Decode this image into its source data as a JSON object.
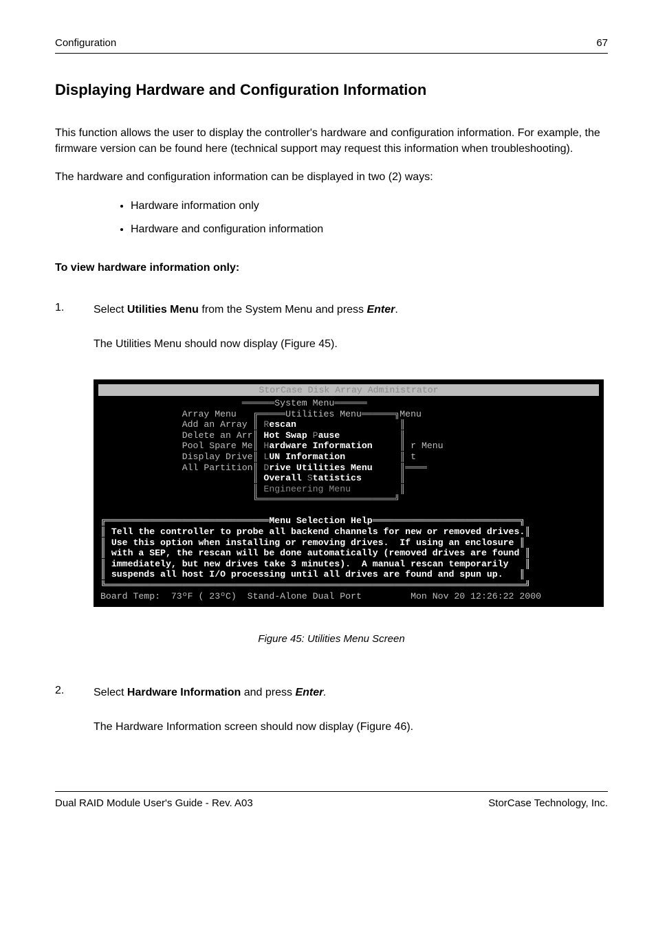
{
  "header": {
    "left": "Configuration",
    "right": "67"
  },
  "section": {
    "title": "Displaying Hardware and Configuration Information",
    "intro_p1": "This function allows the user to display the controller's hardware and configuration information.  For example, the firmware version can be found here (technical support may request this information when troubleshooting).",
    "intro_p2": "The hardware and configuration information can be displayed in two (2) ways:",
    "bullets": [
      "Hardware information only",
      "Hardware and configuration information"
    ],
    "subhead": "To view hardware information only:"
  },
  "steps": {
    "s1": {
      "num": "1.",
      "line1_a": "Select ",
      "line1_b": "Utilities Menu",
      "line1_c": " from the System Menu and press ",
      "line1_d": "Enter",
      "line1_e": ".",
      "line2": "The Utilities Menu should now display (Figure 45)."
    },
    "s2": {
      "num": "2.",
      "line1_a": "Select ",
      "line1_b": "Hardware Information",
      "line1_c": " and press ",
      "line1_d": "Enter",
      "line1_e": ".",
      "line2": "The Hardware Information screen should now display (Figure 46)."
    }
  },
  "terminal": {
    "titlebar": "StorCase Disk Array Administrator",
    "lines": {
      "l01": "                          ══════System Menu══════                          ",
      "l02": "               Array Menu   ╔═════Utilities Menu══════╗Menu                ",
      "l03_a": "               Add an Array ║ ",
      "l03_b": "R",
      "l03_c": "escan",
      "l03_d": "                   ║                    ",
      "l04_a": "               Delete an Arr║ ",
      "l04_b": "Hot Swap ",
      "l04_c": "P",
      "l04_d": "ause",
      "l04_e": "           ║                    ",
      "l05_a": "               Pool Spare Me║ ",
      "l05_b": "H",
      "l05_c": "ardware Information",
      "l05_d": "     ║ r Menu             ",
      "l06_a": "               Display Drive║ ",
      "l06_b": "L",
      "l06_c": "UN Information",
      "l06_d": "          ║ t                  ",
      "l07_a": "               All Partition║ ",
      "l07_b": "D",
      "l07_c": "rive Utilities Menu",
      "l07_d": "     ║════                ",
      "l08_a": "                            ║ ",
      "l08_b": "Overall ",
      "l08_c": "S",
      "l08_d": "tatistics",
      "l08_e": "       ║                    ",
      "l09_a": "                            ║ ",
      "l09_b": "Engineering Menu",
      "l09_c": "         ║                    ",
      "l10": "                            ╚═════════════════════════╝                    ",
      "l11": "                                                                           ",
      "l12": "╔══════════════════════════════Menu Selection Help═══════════════════════════╗",
      "l13": "║ Tell the controller to probe all backend channels for new or removed drives.║",
      "l14": "║ Use this option when installing or removing drives.  If using an enclosure ║",
      "l15": "║ with a SEP, the rescan will be done automatically (removed drives are found ║",
      "l16": "║ immediately, but new drives take 3 minutes).  A manual rescan temporarily   ║",
      "l17": "║ suspends all host I/O processing until all drives are found and spun up.   ║",
      "l18": "╚═════════════════════════════════════════════════════════════════════════════╝",
      "status": "Board Temp:  73ºF ( 23ºC)  Stand-Alone Dual Port         Mon Nov 20 12:26:22 2000"
    }
  },
  "figure_caption": "Figure 45:  Utilities Menu Screen",
  "footer": {
    "left": "Dual RAID Module User's Guide - Rev. A03",
    "right": "StorCase Technology, Inc."
  }
}
